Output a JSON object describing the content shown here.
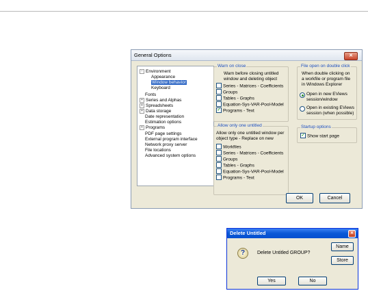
{
  "general_options": {
    "title": "General Options",
    "tree": {
      "items": [
        {
          "label": "Environment",
          "expander": "⊟"
        },
        {
          "label": "Appearance"
        },
        {
          "label": "Window behavior",
          "selected": true
        },
        {
          "label": "Keyboard"
        },
        {
          "label": "Fonts"
        },
        {
          "label": "Series and Alphas",
          "expander": "⊞"
        },
        {
          "label": "Spreadsheets",
          "expander": "⊞"
        },
        {
          "label": "Data storage",
          "expander": "⊞"
        },
        {
          "label": "Date representation"
        },
        {
          "label": "Estimation options"
        },
        {
          "label": "Programs",
          "expander": "⊞"
        },
        {
          "label": "PDF page settings"
        },
        {
          "label": "External program interface"
        },
        {
          "label": "Network proxy server"
        },
        {
          "label": "File locations"
        },
        {
          "label": "Advanced system options"
        }
      ]
    },
    "warn_on_close": {
      "legend": "Warn on close",
      "desc_line1": "Warn before closing untitled",
      "desc_line2": "window and deleting object",
      "items": [
        {
          "label": "Series - Matrices - Coefficients",
          "checked": false
        },
        {
          "label": "Groups",
          "checked": false
        },
        {
          "label": "Tables - Graphs",
          "checked": false
        },
        {
          "label": "Equation-Sys-VAR-Pool-Model",
          "checked": false
        },
        {
          "label": "Programs - Text",
          "checked": true
        }
      ]
    },
    "allow_one_untitled": {
      "legend": "Allow only one untitled",
      "desc_line1": "Allow only one untitled window per",
      "desc_line2": "object type - Replace on new",
      "items": [
        {
          "label": "Workfiles",
          "checked": false
        },
        {
          "label": "Series - Matrices - Coefficients",
          "checked": false
        },
        {
          "label": "Groups",
          "checked": false
        },
        {
          "label": "Tables - Graphs",
          "checked": false
        },
        {
          "label": "Equation-Sys-VAR-Pool-Model",
          "checked": false
        },
        {
          "label": "Programs - Text",
          "checked": false
        }
      ]
    },
    "file_open": {
      "legend": "File open on double click",
      "desc_line1": "When double clicking on",
      "desc_line2": "a workfile or program file",
      "desc_line3": "in Windows Explorer",
      "option1_line1": "Open in new EViews",
      "option1_line2": "session/window",
      "option2_line1": "Open in existing EViews",
      "option2_line2": "session (when possible)",
      "selected": 1
    },
    "startup": {
      "legend": "Startup options",
      "show_start_page": "Show start page",
      "checked": true
    },
    "ok_label": "OK",
    "cancel_label": "Cancel",
    "close_glyph": "✕"
  },
  "delete_untitled": {
    "title": "Delete Untitled",
    "message": "Delete Untitled GROUP?",
    "name_label": "Name",
    "store_label": "Store",
    "yes_label": "Yes",
    "no_label": "No",
    "close_glyph": "✕",
    "question_glyph": "?"
  },
  "colors": {
    "dialog_bg": "#ece9d8",
    "selection": "#3169c6",
    "legend_text": "#1d4fc0",
    "xp_title_blue": "#0a58d6"
  }
}
